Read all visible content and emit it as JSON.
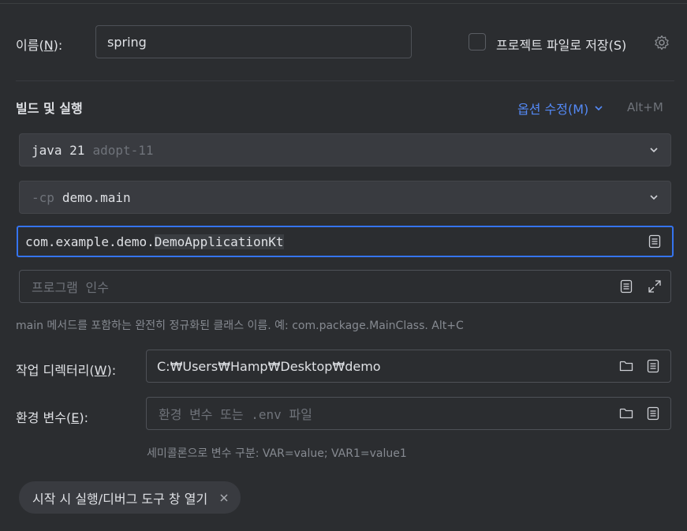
{
  "name": {
    "label_pre": "이름(",
    "label_key": "N",
    "label_post": "):",
    "value": "spring"
  },
  "store_project_file": {
    "label": "프로젝트 파일로 저장(S)",
    "checked": false,
    "icon": "gear-icon"
  },
  "build_run": {
    "section_title": "빌드 및 실행",
    "modify_options_label": "옵션 수정(M)",
    "modify_options_shortcut": "Alt+M",
    "jdk": {
      "name": "java 21",
      "detail": "adopt-11"
    },
    "classpath": {
      "prefix": "-cp",
      "module": "demo.main"
    },
    "main_class": {
      "prefix": "com.example.demo.",
      "highlight": "DemoApplicationKt"
    },
    "program_args": {
      "placeholder": "프로그램 인수"
    },
    "hint": "main 메서드를 포함하는 완전히 정규화된 클래스 이름. 예: com.package.MainClass. Alt+C"
  },
  "working_dir": {
    "label_pre": "작업 디렉터리(",
    "label_key": "W",
    "label_post": "):",
    "value": "C:₩Users₩Hamp₩Desktop₩demo"
  },
  "env_vars": {
    "label_pre": "환경 변수(",
    "label_key": "E",
    "label_post": "):",
    "placeholder": "환경 변수 또는 .env 파일",
    "hint": "세미콜론으로 변수 구분: VAR=value; VAR1=value1"
  },
  "chip": {
    "label": "시작 시 실행/디버그 도구 창 열기"
  },
  "colors": {
    "background": "#2b2d30",
    "accent": "#3574f0",
    "link": "#548af7",
    "muted": "#6f737a"
  }
}
